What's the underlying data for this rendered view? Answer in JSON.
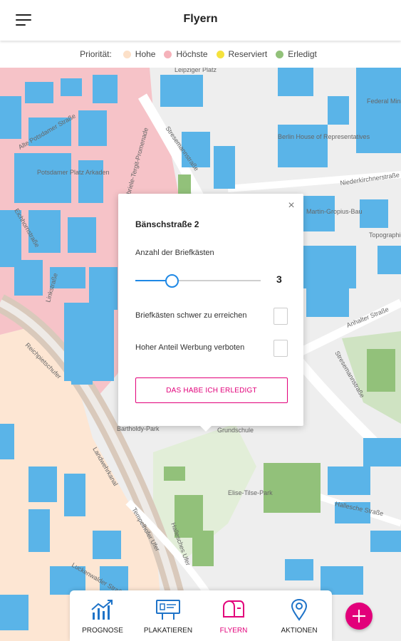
{
  "header": {
    "title": "Flyern",
    "menu_icon": "hamburger-menu-icon"
  },
  "legend": {
    "label": "Priorität:",
    "items": [
      {
        "label": "Hohe",
        "color": "#fce0c8"
      },
      {
        "label": "Höchste",
        "color": "#f5b2ba"
      },
      {
        "label": "Reserviert",
        "color": "#f5e23d"
      },
      {
        "label": "Erledigt",
        "color": "#92c17a"
      }
    ]
  },
  "map": {
    "labels": [
      {
        "text": "Leipziger Platz"
      },
      {
        "text": "Alte Potsdamer Straße"
      },
      {
        "text": "Gabriele-Tergit-Promenade"
      },
      {
        "text": "Stresemannstraße"
      },
      {
        "text": "Potsdamer Platz Arkaden"
      },
      {
        "text": "Eichhornstraße"
      },
      {
        "text": "Linkstraße"
      },
      {
        "text": "Niederkirchnerstraße"
      },
      {
        "text": "Martin-Gropius-Bau"
      },
      {
        "text": "Topographie des Terrors"
      },
      {
        "text": "Anhalter Straße"
      },
      {
        "text": "Reichpietschufer"
      },
      {
        "text": "Bartholdy-Park"
      },
      {
        "text": "Grundschule"
      },
      {
        "text": "Elise-Tilse-Park"
      },
      {
        "text": "Landwehrkanal"
      },
      {
        "text": "Tempelhofer Ufer"
      },
      {
        "text": "Hallesches Ufer"
      },
      {
        "text": "Hallesche Straße"
      },
      {
        "text": "Luckenwalder Straße"
      },
      {
        "text": "Federal Ministry of Finance"
      },
      {
        "text": "Berlin House of Representatives"
      }
    ]
  },
  "popup": {
    "title": "Bänschstraße 2",
    "count_label": "Anzahl der Briefkästen",
    "slider_value": "3",
    "slider_fraction": 0.29,
    "checkbox1_label": "Briefkästen schwer zu erreichen",
    "checkbox1_checked": false,
    "checkbox2_label": "Hoher Anteil Werbung verboten",
    "checkbox2_checked": false,
    "done_label": "DAS HABE ICH ERLEDIGT",
    "close_icon": "close-icon"
  },
  "nav": {
    "items": [
      {
        "label": "PROGNOSE",
        "icon": "chart-icon",
        "active": false
      },
      {
        "label": "PLAKATIEREN",
        "icon": "billboard-icon",
        "active": false
      },
      {
        "label": "FLYERN",
        "icon": "mailbox-icon",
        "active": true
      },
      {
        "label": "AKTIONEN",
        "icon": "location-pin-icon",
        "active": false
      }
    ]
  },
  "colors": {
    "accent": "#e2007a",
    "slider": "#1e88e5",
    "building": "#5ab4e8",
    "park": "#92c17a"
  }
}
